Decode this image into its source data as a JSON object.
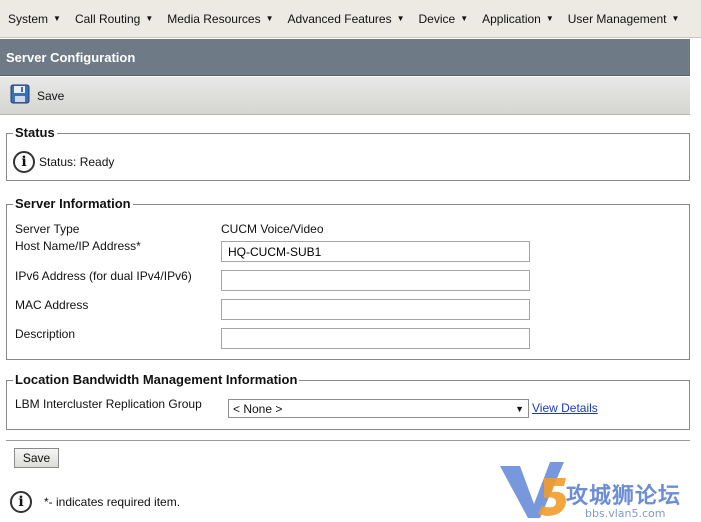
{
  "menu": [
    {
      "label": "System"
    },
    {
      "label": "Call Routing"
    },
    {
      "label": "Media Resources"
    },
    {
      "label": "Advanced Features"
    },
    {
      "label": "Device"
    },
    {
      "label": "Application"
    },
    {
      "label": "User Management"
    }
  ],
  "page_title": "Server Configuration",
  "toolbar": {
    "save_label": "Save"
  },
  "status": {
    "legend": "Status",
    "text": "Status: Ready"
  },
  "server_info": {
    "legend": "Server Information",
    "server_type_label": "Server Type",
    "server_type_value": "CUCM Voice/Video",
    "host_label": "Host Name/IP Address*",
    "host_value": "HQ-CUCM-SUB1",
    "ipv6_label": "IPv6 Address (for dual IPv4/IPv6)",
    "ipv6_value": "",
    "mac_label": "MAC Address",
    "mac_value": "",
    "description_label": "Description",
    "description_value": ""
  },
  "lbm": {
    "legend": "Location Bandwidth Management Information",
    "group_label": "LBM Intercluster Replication Group",
    "group_value": "< None >",
    "view_details": "View Details"
  },
  "footer": {
    "save_label": "Save",
    "required_note": "*- indicates required item."
  },
  "watermark": {
    "text": "攻城狮论坛",
    "sub": "bbs.vlan5.com",
    "logo": "V5"
  },
  "colors": {
    "title_bar": "#6e7a86",
    "menu_bar": "#eceae2",
    "link": "#1a3bbf"
  }
}
